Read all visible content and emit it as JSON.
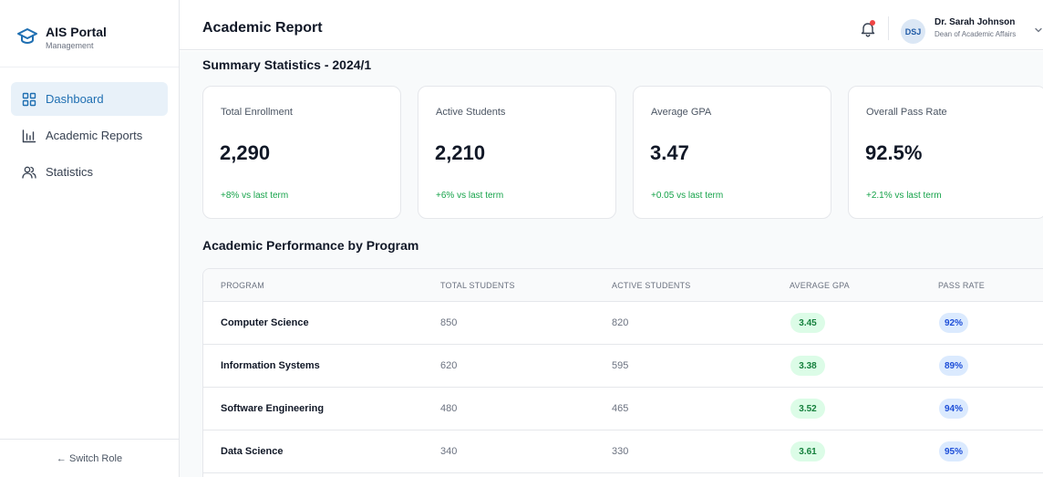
{
  "sidebar": {
    "brand_title": "AIS Portal",
    "brand_subtitle": "Management",
    "items": [
      {
        "label": "Dashboard",
        "icon": "grid-icon",
        "active": true
      },
      {
        "label": "Academic Reports",
        "icon": "bar-chart-icon",
        "active": false
      },
      {
        "label": "Statistics",
        "icon": "users-icon",
        "active": false
      }
    ],
    "switch_role": "← Switch Role"
  },
  "header": {
    "title": "Academic Report",
    "user_initials": "DSJ",
    "user_name": "Dr. Sarah Johnson",
    "user_role": "Dean of Academic Affairs"
  },
  "summary": {
    "title": "Summary Statistics - 2024/1",
    "cards": [
      {
        "label": "Total Enrollment",
        "value": "2,290",
        "change": "+8% vs last term"
      },
      {
        "label": "Active Students",
        "value": "2,210",
        "change": "+6% vs last term"
      },
      {
        "label": "Average GPA",
        "value": "3.47",
        "change": "+0.05 vs last term"
      },
      {
        "label": "Overall Pass Rate",
        "value": "92.5%",
        "change": "+2.1% vs last term"
      }
    ]
  },
  "performance": {
    "title": "Academic Performance by Program",
    "columns": [
      "PROGRAM",
      "TOTAL STUDENTS",
      "ACTIVE STUDENTS",
      "AVERAGE GPA",
      "PASS RATE"
    ],
    "rows": [
      {
        "program": "Computer Science",
        "total": "850",
        "active": "820",
        "gpa": "3.45",
        "pass": "92%"
      },
      {
        "program": "Information Systems",
        "total": "620",
        "active": "595",
        "gpa": "3.38",
        "pass": "89%"
      },
      {
        "program": "Software Engineering",
        "total": "480",
        "active": "465",
        "gpa": "3.52",
        "pass": "94%"
      },
      {
        "program": "Data Science",
        "total": "340",
        "active": "330",
        "gpa": "3.61",
        "pass": "95%"
      }
    ]
  },
  "colors": {
    "accent": "#1f6fb2",
    "positive": "#16a34a",
    "gpa_badge_bg": "#dcfce7",
    "pass_badge_bg": "#dbeafe",
    "notification_dot": "#ef4444"
  }
}
